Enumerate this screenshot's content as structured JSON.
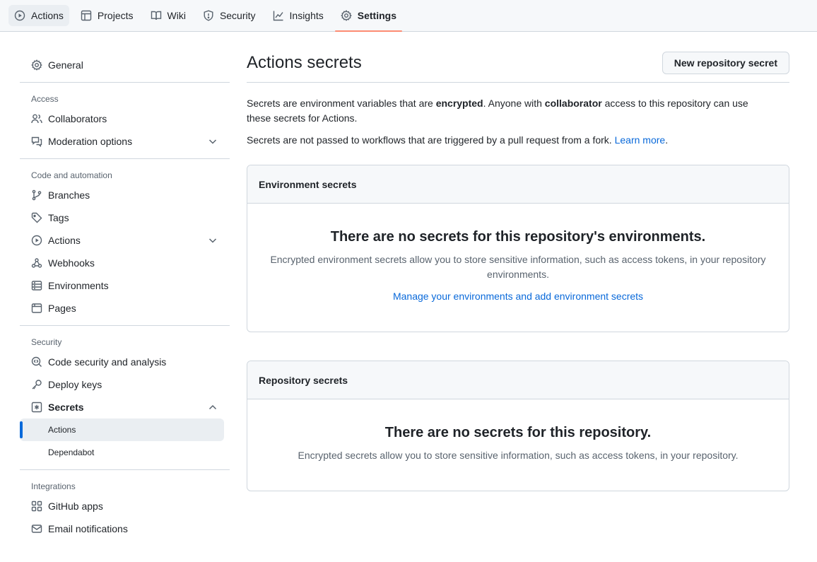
{
  "nav": {
    "tabs": [
      {
        "label": "Actions",
        "icon": "play-icon"
      },
      {
        "label": "Projects",
        "icon": "table-icon"
      },
      {
        "label": "Wiki",
        "icon": "book-icon"
      },
      {
        "label": "Security",
        "icon": "shield-icon"
      },
      {
        "label": "Insights",
        "icon": "graph-icon"
      },
      {
        "label": "Settings",
        "icon": "gear-icon"
      }
    ],
    "active_accent": "#fd8c73"
  },
  "sidebar": {
    "general": "General",
    "access_heading": "Access",
    "collaborators": "Collaborators",
    "moderation": "Moderation options",
    "code_heading": "Code and automation",
    "branches": "Branches",
    "tags": "Tags",
    "actions": "Actions",
    "webhooks": "Webhooks",
    "environments": "Environments",
    "pages": "Pages",
    "security_heading": "Security",
    "code_security": "Code security and analysis",
    "deploy_keys": "Deploy keys",
    "secrets": "Secrets",
    "secrets_actions": "Actions",
    "secrets_dependabot": "Dependabot",
    "integrations_heading": "Integrations",
    "github_apps": "GitHub apps",
    "email_notifications": "Email notifications"
  },
  "main": {
    "title": "Actions secrets",
    "new_button": "New repository secret",
    "desc": {
      "p1_a": "Secrets are environment variables that are ",
      "p1_b": "encrypted",
      "p1_c": ". Anyone with ",
      "p1_d": "collaborator",
      "p1_e": " access to this repository can use these secrets for Actions.",
      "p2_a": "Secrets are not passed to workflows that are triggered by a pull request from a fork. ",
      "p2_link": "Learn more",
      "p2_end": "."
    },
    "env": {
      "header": "Environment secrets",
      "blank_title": "There are no secrets for this repository's environments.",
      "blank_text": "Encrypted environment secrets allow you to store sensitive information, such as access tokens, in your repository environments.",
      "link": "Manage your environments and add environment secrets"
    },
    "repo": {
      "header": "Repository secrets",
      "blank_title": "There are no secrets for this repository.",
      "blank_text": "Encrypted secrets allow you to store sensitive information, such as access tokens, in your repository."
    }
  },
  "colors": {
    "link": "#0969da",
    "selected_bar": "#0969da",
    "border": "#d0d7de"
  }
}
